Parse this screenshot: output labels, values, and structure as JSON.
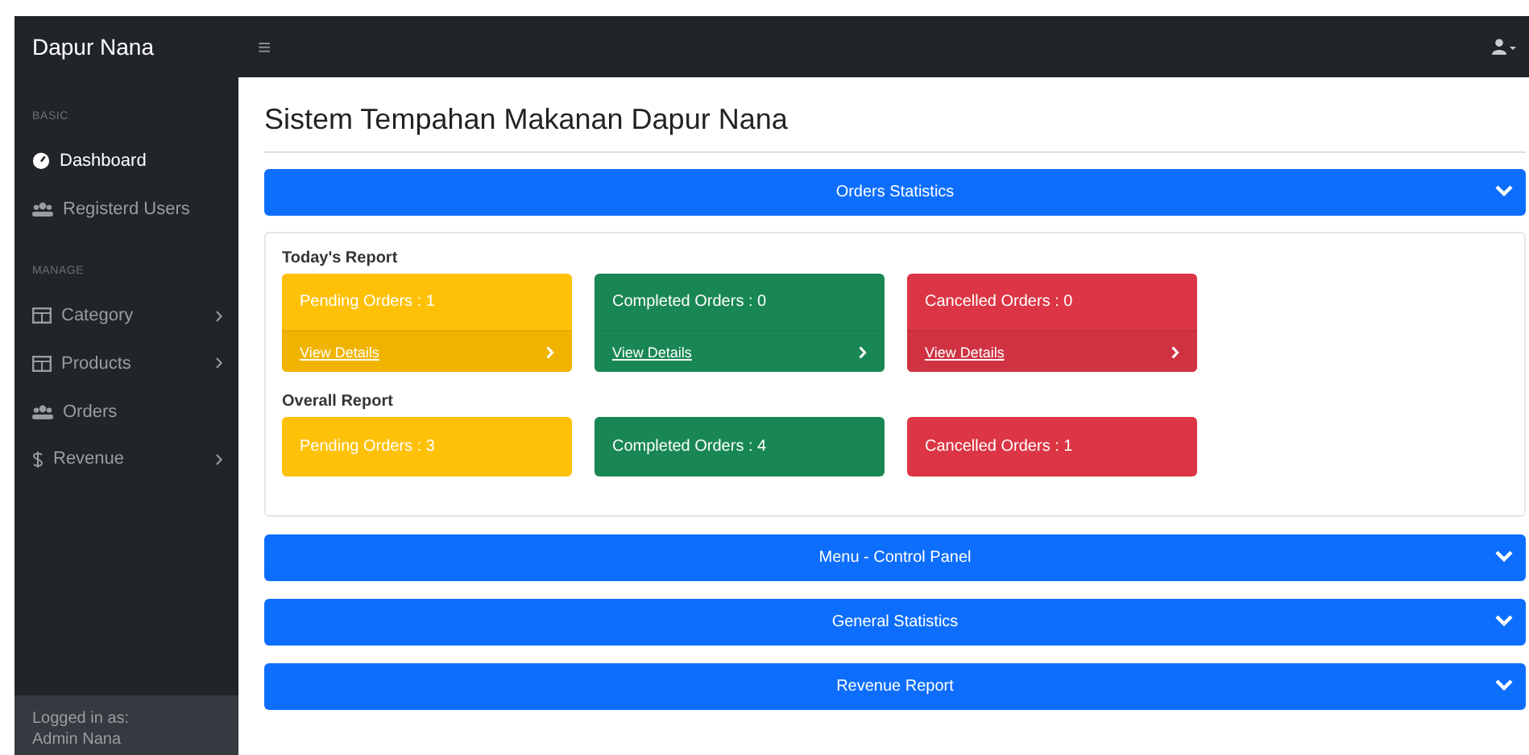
{
  "brand": "Dapur Nana",
  "topbar": {
    "menu_icon": "≡"
  },
  "sidebar": {
    "sections": [
      {
        "heading": "BASIC",
        "items": [
          {
            "label": "Dashboard",
            "kind": "dashboard",
            "selected": true,
            "expandable": false
          },
          {
            "label": "Registerd Users",
            "kind": "users",
            "selected": false,
            "expandable": false
          }
        ]
      },
      {
        "heading": "MANAGE",
        "items": [
          {
            "label": "Category",
            "kind": "table",
            "selected": false,
            "expandable": true
          },
          {
            "label": "Products",
            "kind": "table",
            "selected": false,
            "expandable": true
          },
          {
            "label": "Orders",
            "kind": "users",
            "selected": false,
            "expandable": false
          },
          {
            "label": "Revenue",
            "kind": "dollar",
            "selected": false,
            "expandable": true
          }
        ]
      }
    ],
    "footer": {
      "caption": "Logged in as:",
      "user": "Admin Nana"
    }
  },
  "page_title": "Sistem Tempahan Makanan Dapur Nana",
  "panels": [
    {
      "title": "Orders Statistics",
      "reports": [
        {
          "heading": "Today's Report",
          "cards": [
            {
              "kind": "warning",
              "text": "Pending Orders : 1",
              "link": "View Details"
            },
            {
              "kind": "success",
              "text": "Completed Orders : 0",
              "link": "View Details"
            },
            {
              "kind": "danger",
              "text": "Cancelled Orders : 0",
              "link": "View Details"
            }
          ]
        },
        {
          "heading": "Overall Report",
          "cards": [
            {
              "kind": "warning",
              "text": "Pending Orders : 3"
            },
            {
              "kind": "success",
              "text": "Completed Orders : 4"
            },
            {
              "kind": "danger",
              "text": "Cancelled Orders : 1"
            }
          ]
        }
      ]
    },
    {
      "title": "Menu - Control Panel"
    },
    {
      "title": "General Statistics"
    },
    {
      "title": "Revenue Report"
    }
  ]
}
